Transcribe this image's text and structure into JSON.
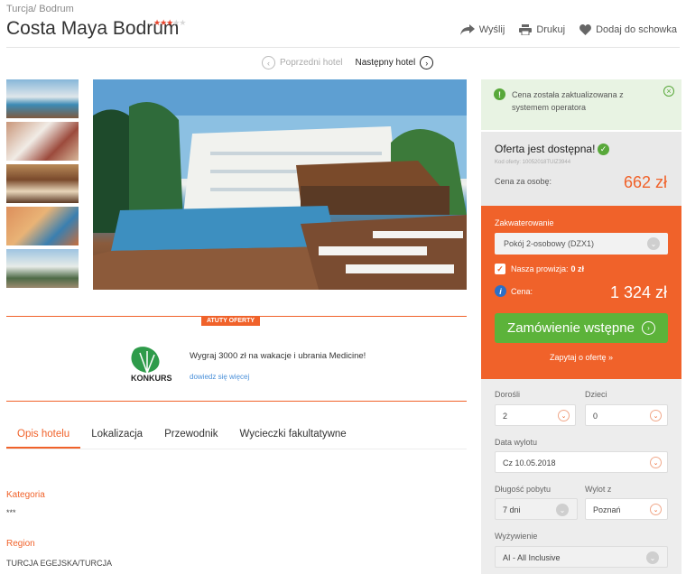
{
  "breadcrumb": {
    "country": "Turcja",
    "separator": "/",
    "region": "Bodrum"
  },
  "hotel": {
    "name": "Costa Maya Bodrum",
    "stars": 3,
    "stars_max": 5
  },
  "actions": {
    "send": "Wyślij",
    "print": "Drukuj",
    "save": "Dodaj do schowka"
  },
  "hotel_nav": {
    "prev": "Poprzedni hotel",
    "next": "Następny hotel"
  },
  "badge": "ATUTY OFERTY",
  "promo": {
    "logo_text": "KONKURS",
    "text": "Wygraj 3000 zł na wakacje i ubrania Medicine!",
    "link": "dowiedz się więcej"
  },
  "tabs": [
    {
      "label": "Opis hotelu",
      "active": true
    },
    {
      "label": "Lokalizacja",
      "active": false
    },
    {
      "label": "Przewodnik",
      "active": false
    },
    {
      "label": "Wycieczki fakultatywne",
      "active": false
    }
  ],
  "details": {
    "category_label": "Kategoria",
    "category_value": "***",
    "region_label": "Region",
    "region_value": "TURCJA EGEJSKA/TURCJA"
  },
  "notice": {
    "text": "Cena została zaktualizowana z systemem operatora"
  },
  "offer": {
    "title": "Oferta jest dostępna!",
    "code": "Kod oferty: 10052018TUIZ3944",
    "price_label": "Cena za osobę:",
    "price_value": "662 zł"
  },
  "booking": {
    "accommodation_label": "Zakwaterowanie",
    "room": "Pokój 2-osobowy (DZX1)",
    "commission_label": "Nasza prowizja:",
    "commission_value": "0 zł",
    "total_label": "Cena:",
    "total_value": "1 324 zł",
    "order_button": "Zamówienie wstępne",
    "ask_link": "Zapytaj o ofertę »"
  },
  "form": {
    "adults_label": "Dorośli",
    "adults_value": "2",
    "children_label": "Dzieci",
    "children_value": "0",
    "date_label": "Data wylotu",
    "date_value": "Cz 10.05.2018",
    "length_label": "Długość pobytu",
    "length_value": "7 dni",
    "from_label": "Wylot z",
    "from_value": "Poznań",
    "board_label": "Wyżywienie",
    "board_value": "AI - All Inclusive"
  },
  "colors": {
    "accent": "#f0622a",
    "green": "#5cb33a",
    "notice_bg": "#e8f3e3"
  }
}
